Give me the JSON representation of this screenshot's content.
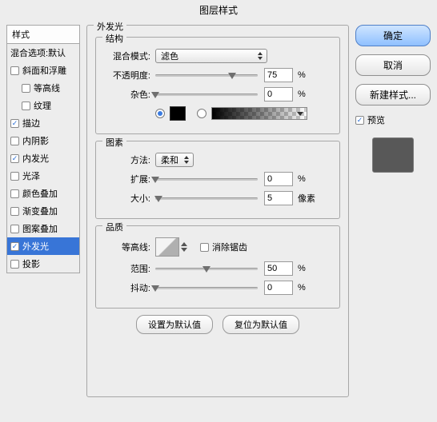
{
  "title": "图层样式",
  "styles_header": "样式",
  "styles_list": [
    {
      "label": "混合选项:默认",
      "checked": null,
      "indent": false,
      "selected": false
    },
    {
      "label": "斜面和浮雕",
      "checked": false,
      "indent": false,
      "selected": false
    },
    {
      "label": "等高线",
      "checked": false,
      "indent": true,
      "selected": false
    },
    {
      "label": "纹理",
      "checked": false,
      "indent": true,
      "selected": false
    },
    {
      "label": "描边",
      "checked": true,
      "indent": false,
      "selected": false
    },
    {
      "label": "内阴影",
      "checked": false,
      "indent": false,
      "selected": false
    },
    {
      "label": "内发光",
      "checked": true,
      "indent": false,
      "selected": false
    },
    {
      "label": "光泽",
      "checked": false,
      "indent": false,
      "selected": false
    },
    {
      "label": "颜色叠加",
      "checked": false,
      "indent": false,
      "selected": false
    },
    {
      "label": "渐变叠加",
      "checked": false,
      "indent": false,
      "selected": false
    },
    {
      "label": "图案叠加",
      "checked": false,
      "indent": false,
      "selected": false
    },
    {
      "label": "外发光",
      "checked": true,
      "indent": false,
      "selected": true
    },
    {
      "label": "投影",
      "checked": false,
      "indent": false,
      "selected": false
    }
  ],
  "outer_legend": "外发光",
  "structure": {
    "legend": "结构",
    "blend_label": "混合模式:",
    "blend_value": "滤色",
    "opacity_label": "不透明度:",
    "opacity_value": "75",
    "opacity_unit": "%",
    "noise_label": "杂色:",
    "noise_value": "0",
    "noise_unit": "%"
  },
  "elements": {
    "legend": "图素",
    "method_label": "方法:",
    "method_value": "柔和",
    "spread_label": "扩展:",
    "spread_value": "0",
    "spread_unit": "%",
    "size_label": "大小:",
    "size_value": "5",
    "size_unit": "像素"
  },
  "quality": {
    "legend": "品质",
    "contour_label": "等高线:",
    "antialias_label": "消除锯齿",
    "antialias_checked": false,
    "range_label": "范围:",
    "range_value": "50",
    "range_unit": "%",
    "jitter_label": "抖动:",
    "jitter_value": "0",
    "jitter_unit": "%"
  },
  "bottom": {
    "make_default": "设置为默认值",
    "reset_default": "复位为默认值"
  },
  "side": {
    "ok": "确定",
    "cancel": "取消",
    "new_style": "新建样式...",
    "preview": "预览",
    "preview_checked": true
  },
  "slider_positions": {
    "opacity": 75,
    "noise": 0,
    "spread": 0,
    "size": 3,
    "range": 50,
    "jitter": 0
  }
}
